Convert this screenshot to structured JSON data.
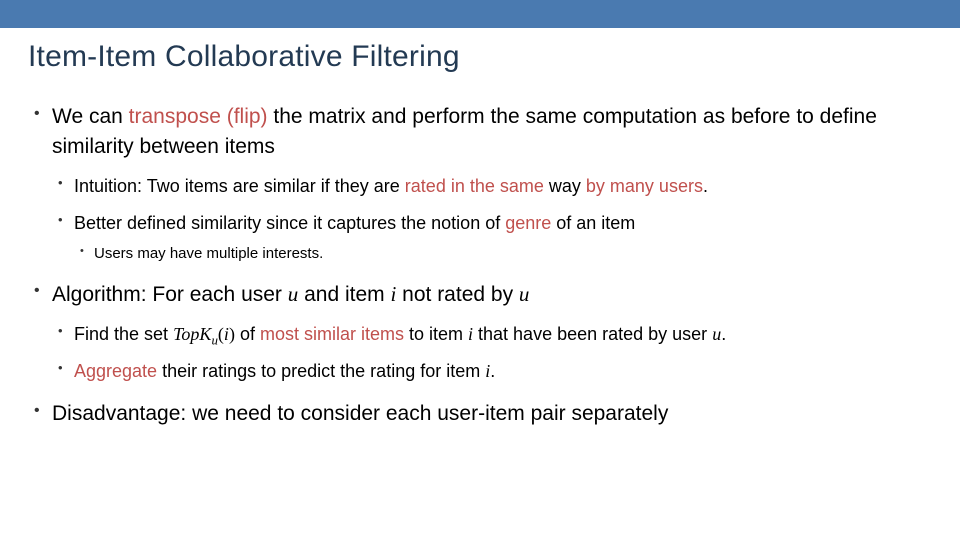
{
  "colors": {
    "accent_bar": "#4a7ab0",
    "title": "#233a53",
    "highlight": "#c0504d"
  },
  "title": "Item-Item Collaborative Filtering",
  "b1": {
    "p1a": "We can ",
    "hl1": "transpose (flip) ",
    "p1b": "the matrix and perform the same computation as before to define similarity between items",
    "s1": {
      "a": "Intuition: Two items are similar if they are ",
      "hl1": "rated in the same ",
      "b": "way ",
      "hl2": "by many users",
      "c": "."
    },
    "s2": {
      "a": "Better defined similarity since it captures the notion of ",
      "hl1": "genre ",
      "b": "of an item",
      "ss1": "Users may have multiple interests."
    }
  },
  "b2": {
    "a": "Algorithm: For each user ",
    "m_u": "u",
    "b": " and item ",
    "m_i": "i",
    "c": " not rated by ",
    "s1": {
      "a": "Find the set ",
      "topk_pref": "TopK",
      "topk_sub": "u",
      "topk_arg_open": "(",
      "topk_arg": "i",
      "topk_arg_close": ")",
      "b": " of ",
      "hl1": "most similar items ",
      "c": "to item ",
      "d": " that have been rated by user ",
      "e": "."
    },
    "s2": {
      "hl1": "Aggregate ",
      "a": "their ratings to predict the rating for item ",
      "b": "."
    }
  },
  "b3": {
    "a": "Disadvantage: we need to consider each user-item pair separately"
  }
}
